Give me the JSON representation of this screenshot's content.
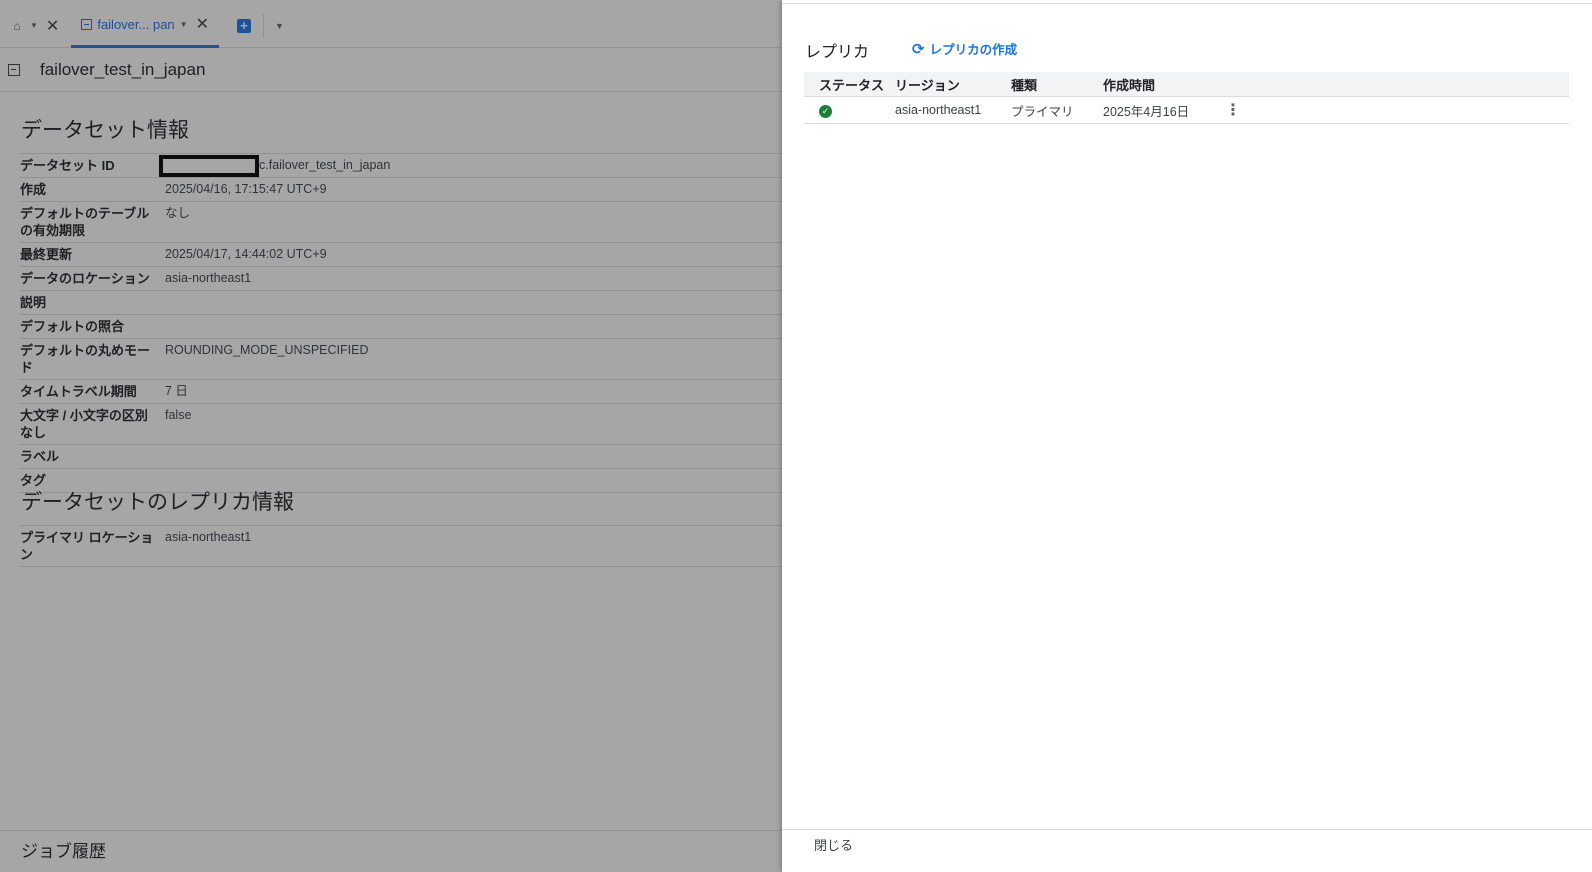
{
  "tabs": {
    "home_icon": "home-icon",
    "active_label": "failover... pan",
    "close_glyph": "✕"
  },
  "page": {
    "title": "failover_test_in_japan"
  },
  "dataset_info": {
    "heading": "データセット情報",
    "rows": [
      {
        "key": "データセット ID",
        "value": "c.failover_test_in_japan"
      },
      {
        "key": "作成",
        "value": "2025/04/16, 17:15:47 UTC+9"
      },
      {
        "key": "デフォルトのテーブルの有効期限",
        "value": "なし"
      },
      {
        "key": "最終更新",
        "value": "2025/04/17, 14:44:02 UTC+9"
      },
      {
        "key": "データのロケーション",
        "value": "asia-northeast1"
      },
      {
        "key": "説明",
        "value": ""
      },
      {
        "key": "デフォルトの照合",
        "value": ""
      },
      {
        "key": "デフォルトの丸めモード",
        "value": "ROUNDING_MODE_UNSPECIFIED"
      },
      {
        "key": "タイムトラベル期間",
        "value": "7 日"
      },
      {
        "key": "大文字 / 小文字の区別なし",
        "value": "false"
      },
      {
        "key": "ラベル",
        "value": ""
      },
      {
        "key": "タグ",
        "value": ""
      }
    ]
  },
  "replica_info": {
    "heading": "データセットのレプリカ情報",
    "rows": [
      {
        "key": "プライマリ ロケーション",
        "value": "asia-northeast1"
      }
    ]
  },
  "job_history": "ジョブ履歴",
  "panel": {
    "title": "レプリカ",
    "create_label": "レプリカの作成",
    "columns": [
      "ステータス",
      "リージョン",
      "種類",
      "作成時間"
    ],
    "rows": [
      {
        "status": "check-circle-icon",
        "region": "asia-northeast1",
        "type": "プライマリ",
        "created": "2025年4月16日"
      }
    ],
    "close_label": "閉じる"
  }
}
